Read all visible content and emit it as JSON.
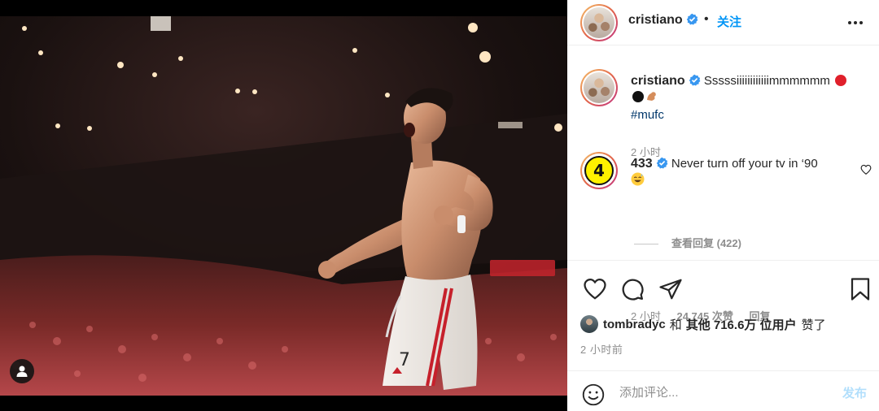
{
  "colors": {
    "accent": "#0095f6",
    "verified": "#3897f0",
    "text": "#262626",
    "muted": "#8e8e8e",
    "hashtag": "#00376b",
    "post_button_disabled": "#b2dffc"
  },
  "header": {
    "username": "cristiano",
    "verified_icon": "verified-badge-icon",
    "separator": "•",
    "follow_label": "关注",
    "more_icon": "more-options-icon"
  },
  "media": {
    "alt": "Player celebrating shirtless in a stadium at night",
    "tag_icon": "user-tag-icon"
  },
  "caption": {
    "username": "cristiano",
    "text": "Sssssiiiiiiiiiiiimmmmmm",
    "emojis": [
      "red-circle",
      "black-circle",
      "flexed-biceps"
    ],
    "hashtag": "#mufc",
    "time": "2 小时"
  },
  "top_comment": {
    "username": "433",
    "avatar_label": "4",
    "text": "Never turn off your tv in ‘90",
    "emoji": "sweat-smile",
    "time": "2 小时",
    "likes": "24,745 次赞",
    "reply_label": "回复",
    "view_replies": "查看回复 (422)"
  },
  "actions": {
    "like_icon": "heart-icon",
    "comment_icon": "comment-icon",
    "share_icon": "share-icon",
    "save_icon": "bookmark-icon"
  },
  "likes": {
    "user": "tombradyc",
    "connector": "和",
    "others": "其他 716.6万 位用户",
    "suffix": "赞了"
  },
  "post_time": "2 小时前",
  "comment_box": {
    "emoji_icon": "smiley-icon",
    "placeholder": "添加评论...",
    "post_label": "发布"
  }
}
